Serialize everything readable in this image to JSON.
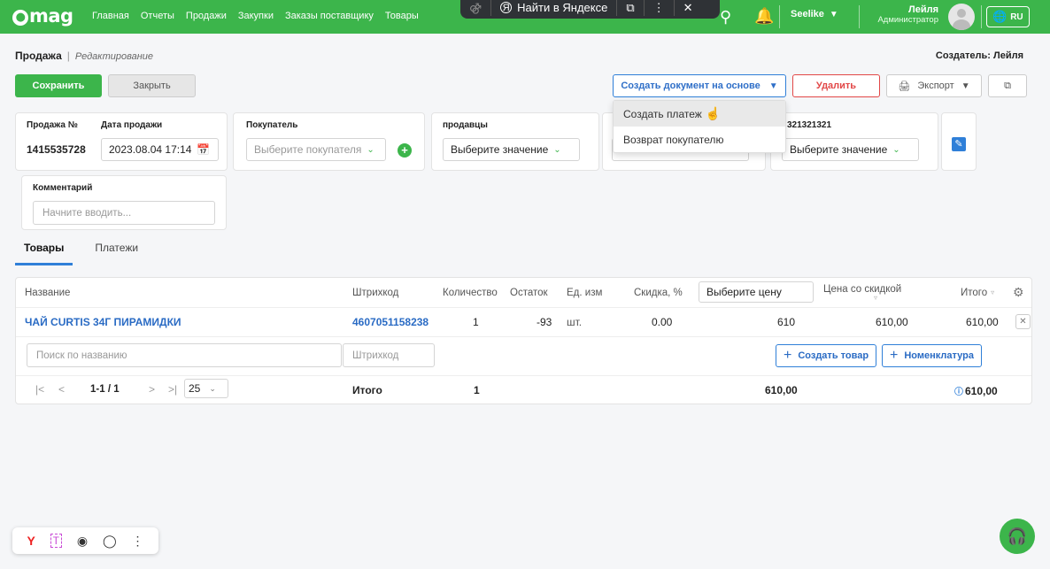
{
  "brand": {
    "logo": "umag",
    "accent": "#3cb54b"
  },
  "nav": [
    "Главная",
    "Отчеты",
    "Продажи",
    "Закупки",
    "Заказы поставщику",
    "Товары"
  ],
  "yandex_bar": {
    "find_label": "Найти в Яндексе"
  },
  "header": {
    "company": "Seelike",
    "user_name": "Лейля",
    "user_role": "Администратор",
    "lang": "RU"
  },
  "page": {
    "title": "Продажа",
    "mode": "Редактирование",
    "creator": "Создатель: Лейля"
  },
  "toolbar": {
    "save": "Сохранить",
    "close": "Закрыть",
    "create_doc": "Создать документ на основе",
    "delete": "Удалить",
    "export": "Экспорт"
  },
  "dropdown": {
    "items": [
      "Создать платеж",
      "Возврат покупателю"
    ]
  },
  "form": {
    "sale_no_label": "Продажа №",
    "sale_no": "1415535728",
    "date_label": "Дата продажи",
    "date": "2023.08.04 17:14",
    "buyer_label": "Покупатель",
    "buyer_placeholder": "Выберите покупателя",
    "sellers_label": "продавцы",
    "sellers_value": "Выберите значение",
    "field5_label": "321321321",
    "field5_value": "Выберите значение",
    "comment_label": "Комментарий",
    "comment_placeholder": "Начните вводить..."
  },
  "tabs": [
    "Товары",
    "Платежи"
  ],
  "table": {
    "headers": {
      "name": "Название",
      "barcode": "Штрихкод",
      "qty": "Количество",
      "stock": "Остаток",
      "unit": "Ед. изм",
      "discount": "Скидка, %",
      "price_select": "Выберите цену",
      "discount_price": "Цена со скидкой",
      "total": "Итого"
    },
    "rows": [
      {
        "name": "ЧАЙ CURTIS 34Г ПИРАМИДКИ",
        "barcode": "4607051158238",
        "qty": "1",
        "stock": "-93",
        "unit": "шт.",
        "discount": "0.00",
        "price": "610",
        "discount_price": "610,00",
        "total": "610,00"
      }
    ],
    "search_name_placeholder": "Поиск по названию",
    "search_barcode_placeholder": "Штрихкод",
    "create_product": "Создать товар",
    "nomenclature": "Номенклатура",
    "pagination": {
      "range": "1-1 / 1",
      "page_size": "25"
    },
    "footer": {
      "label": "Итого",
      "qty": "1",
      "sum": "610,00",
      "total": "610,00"
    }
  }
}
